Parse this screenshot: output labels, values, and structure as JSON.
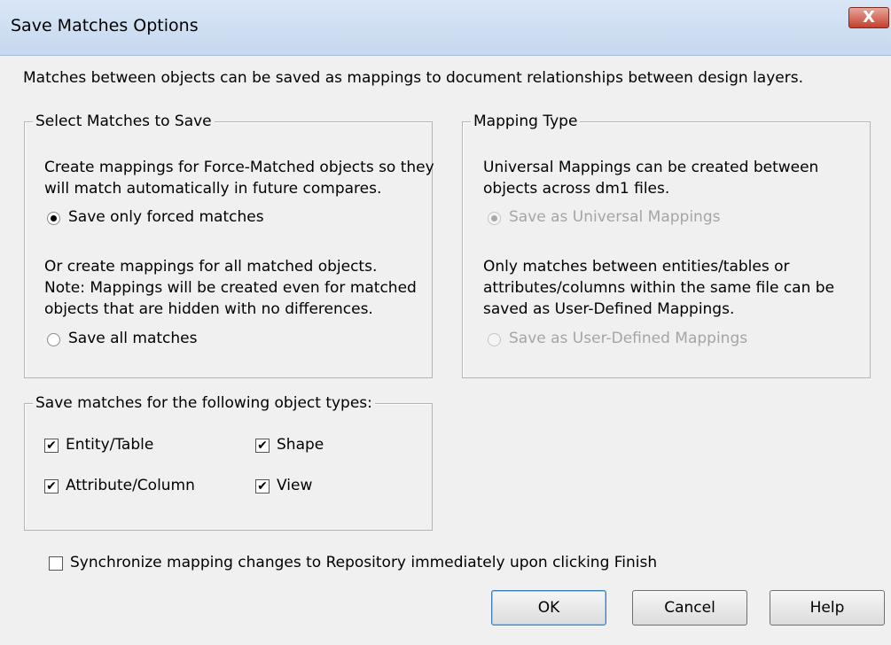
{
  "window": {
    "title": "Save Matches Options",
    "close_glyph": "X",
    "intro": "Matches between objects can be saved as mappings to document relationships between design layers."
  },
  "select_group": {
    "legend": "Select Matches to Save",
    "desc1_line1": "Create mappings for Force-Matched objects so they",
    "desc1_line2": "will match automatically in future compares.",
    "radio_forced": {
      "label": "Save only forced matches",
      "selected": true
    },
    "desc2_line1": "Or create mappings for all matched objects.",
    "desc2_line2": "Note: Mappings will be created even for matched",
    "desc2_line3": "objects that are hidden with no differences.",
    "radio_all": {
      "label": "Save all matches",
      "selected": false
    }
  },
  "mapping_group": {
    "legend": "Mapping Type",
    "desc1_line1": "Universal Mappings can be created between",
    "desc1_line2": "objects across dm1 files.",
    "radio_universal": {
      "label": "Save as Universal Mappings",
      "selected": true,
      "enabled": false
    },
    "desc2_line1": "Only matches between entities/tables or",
    "desc2_line2": "attributes/columns within the same file can be",
    "desc2_line3": "saved as User-Defined Mappings.",
    "radio_user": {
      "label": "Save as User-Defined Mappings",
      "selected": false,
      "enabled": false
    }
  },
  "types_group": {
    "legend": "Save matches for the following object types:",
    "entity": {
      "label": "Entity/Table",
      "checked": true
    },
    "attribute": {
      "label": "Attribute/Column",
      "checked": true
    },
    "shape": {
      "label": "Shape",
      "checked": true
    },
    "view": {
      "label": "View",
      "checked": true
    }
  },
  "sync": {
    "label": "Synchronize mapping changes to Repository immediately upon clicking Finish",
    "checked": false
  },
  "buttons": {
    "ok": "OK",
    "cancel": "Cancel",
    "help": "Help"
  },
  "check_glyph": "✔"
}
